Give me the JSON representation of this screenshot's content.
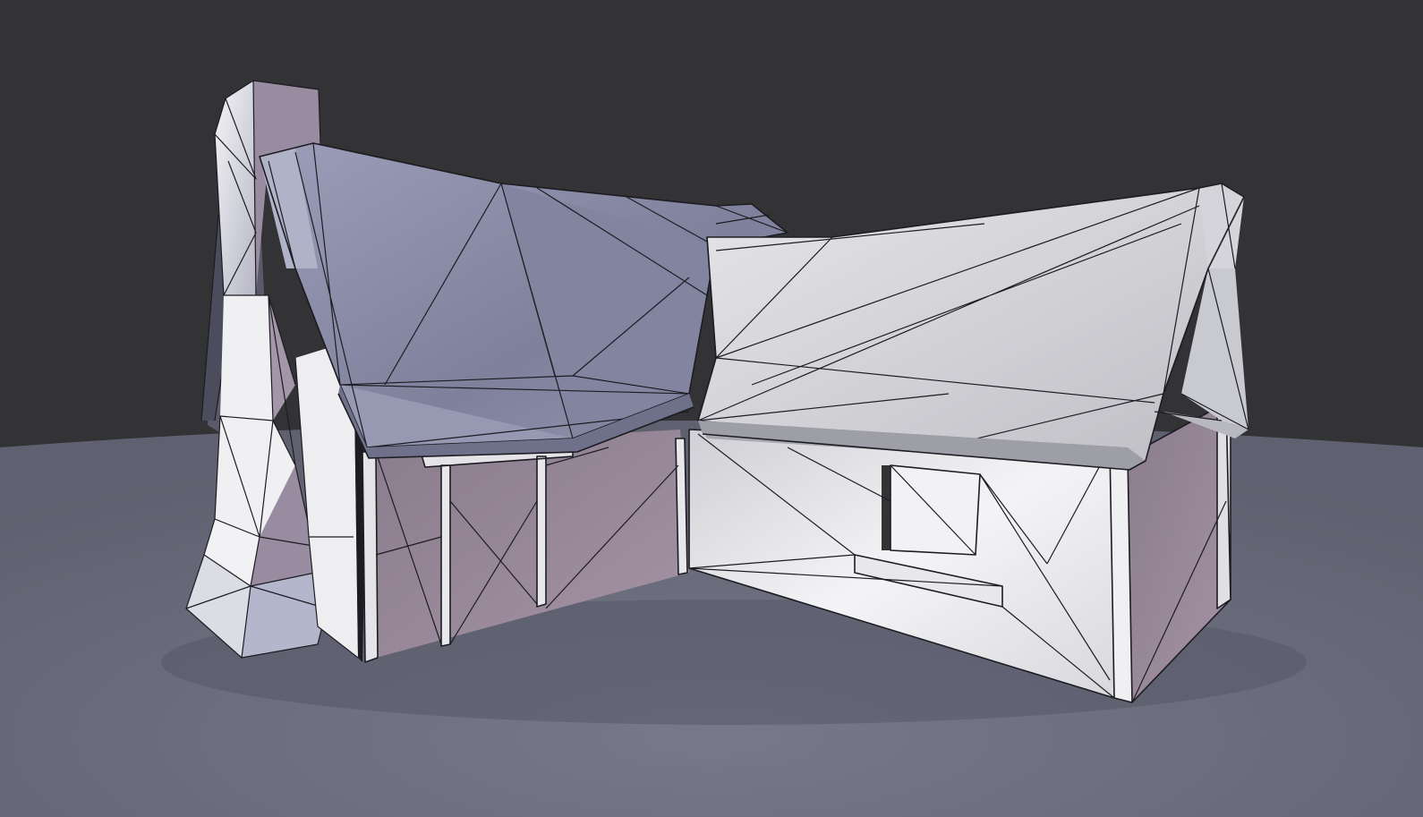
{
  "scene": {
    "kind": "3d-viewport-render",
    "subject": "low-poly-cottage-wireframe-shaded",
    "colors": {
      "background": "#333335",
      "ground": "#6e7080",
      "roof_left": "#8a8ca6",
      "roof_right": "#d4d4d8",
      "wall_light": "#ececee",
      "wall_mauve": "#9c8c9c",
      "chimney": "#dcdce2",
      "edge": "#1c1c22"
    }
  }
}
